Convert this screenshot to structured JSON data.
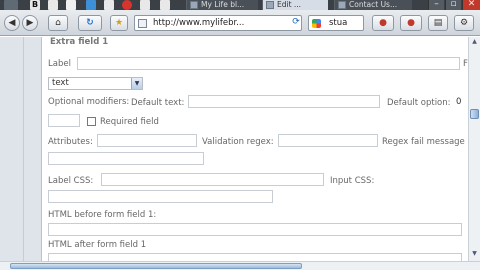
{
  "tabs": [
    {
      "label": "My Life bl..."
    },
    {
      "label": "Edit ..."
    },
    {
      "label": "Contact Us..."
    }
  ],
  "toolbar": {
    "url": "http://www.mylifebr...",
    "search_text": "stua"
  },
  "window": {
    "minimize": "–",
    "restore": "▫",
    "close": "✕"
  },
  "form": {
    "section_title": "Extra field 1",
    "label_label": "Label",
    "label_value": "",
    "type_value": "text",
    "optional_modifiers_label": "Optional modifiers:",
    "default_text_label": "Default text:",
    "default_option_label": "Default option:",
    "default_option_value": "0",
    "required_label": "Required field",
    "attributes_label": "Attributes:",
    "validation_regex_label": "Validation regex:",
    "regex_fail_label": "Regex fail message",
    "label_css_label": "Label CSS:",
    "input_css_label": "Input CSS:",
    "html_before_label": "HTML before form field 1:",
    "html_after_label": "HTML after form field 1"
  },
  "colors": {
    "tabbar": "#3b4046",
    "page_bg": "#dfe4ea",
    "label_text": "#666666"
  }
}
